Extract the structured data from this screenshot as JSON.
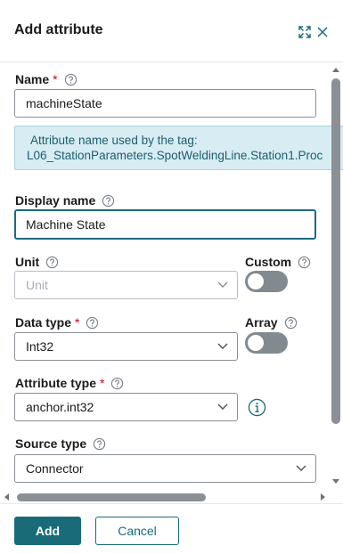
{
  "dialog": {
    "title": "Add attribute",
    "expand_icon": "expand-icon",
    "close_icon": "close-icon"
  },
  "form": {
    "name": {
      "label": "Name",
      "required_mark": "*",
      "value": "machineState"
    },
    "info_message": {
      "line1": "Attribute name used by the tag:",
      "line2": "L06_StationParameters.SpotWeldingLine.Station1.Proc"
    },
    "display_name": {
      "label": "Display name",
      "value": "Machine State"
    },
    "unit": {
      "label": "Unit",
      "placeholder": "Unit"
    },
    "custom": {
      "label": "Custom",
      "state": "off"
    },
    "data_type": {
      "label": "Data type",
      "required_mark": "*",
      "value": "Int32"
    },
    "array": {
      "label": "Array",
      "state": "off"
    },
    "attribute_type": {
      "label": "Attribute type",
      "required_mark": "*",
      "value": "anchor.int32"
    },
    "source_type": {
      "label": "Source type",
      "value": "Connector"
    }
  },
  "footer": {
    "add_label": "Add",
    "cancel_label": "Cancel"
  },
  "colors": {
    "accent": "#1a6b7a",
    "required": "#d0021b",
    "info_bg": "#d7ecf3",
    "toggle_off": "#818991"
  }
}
